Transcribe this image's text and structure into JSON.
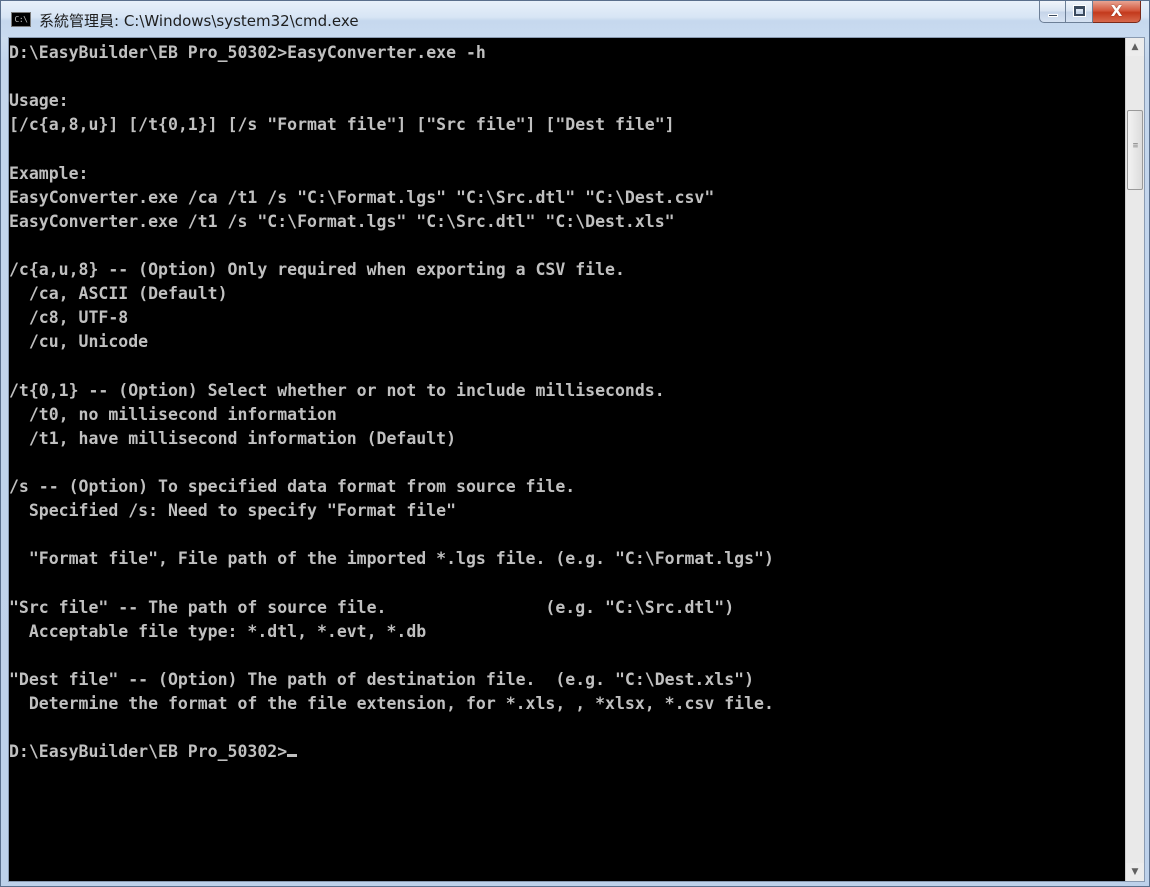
{
  "window": {
    "icon_text": "C:\\",
    "title": "系統管理員: C:\\Windows\\system32\\cmd.exe",
    "minimize_label": "",
    "maximize_label": "",
    "close_label": "X"
  },
  "console": {
    "lines": [
      "D:\\EasyBuilder\\EB Pro_50302>EasyConverter.exe -h",
      "",
      "Usage:",
      "[/c{a,8,u}] [/t{0,1}] [/s \"Format file\"] [\"Src file\"] [\"Dest file\"]",
      "",
      "Example:",
      "EasyConverter.exe /ca /t1 /s \"C:\\Format.lgs\" \"C:\\Src.dtl\" \"C:\\Dest.csv\"",
      "EasyConverter.exe /t1 /s \"C:\\Format.lgs\" \"C:\\Src.dtl\" \"C:\\Dest.xls\"",
      "",
      "/c{a,u,8} -- (Option) Only required when exporting a CSV file.",
      "  /ca, ASCII (Default)",
      "  /c8, UTF-8",
      "  /cu, Unicode",
      "",
      "/t{0,1} -- (Option) Select whether or not to include milliseconds.",
      "  /t0, no millisecond information",
      "  /t1, have millisecond information (Default)",
      "",
      "/s -- (Option) To specified data format from source file.",
      "  Specified /s: Need to specify \"Format file\"",
      "",
      "  \"Format file\", File path of the imported *.lgs file. (e.g. \"C:\\Format.lgs\")",
      "",
      "\"Src file\" -- The path of source file.                (e.g. \"C:\\Src.dtl\")",
      "  Acceptable file type: *.dtl, *.evt, *.db",
      "",
      "\"Dest file\" -- (Option) The path of destination file.  (e.g. \"C:\\Dest.xls\")",
      "  Determine the format of the file extension, for *.xls, , *xlsx, *.csv file.",
      "",
      "D:\\EasyBuilder\\EB Pro_50302>"
    ]
  },
  "scrollbar": {
    "up_arrow": "▲",
    "down_arrow": "▼",
    "grip": "≡",
    "position_fraction": 0.06
  },
  "colors": {
    "console_bg": "#000000",
    "console_fg": "#c0c0c0",
    "close_button": "#c3391c"
  }
}
